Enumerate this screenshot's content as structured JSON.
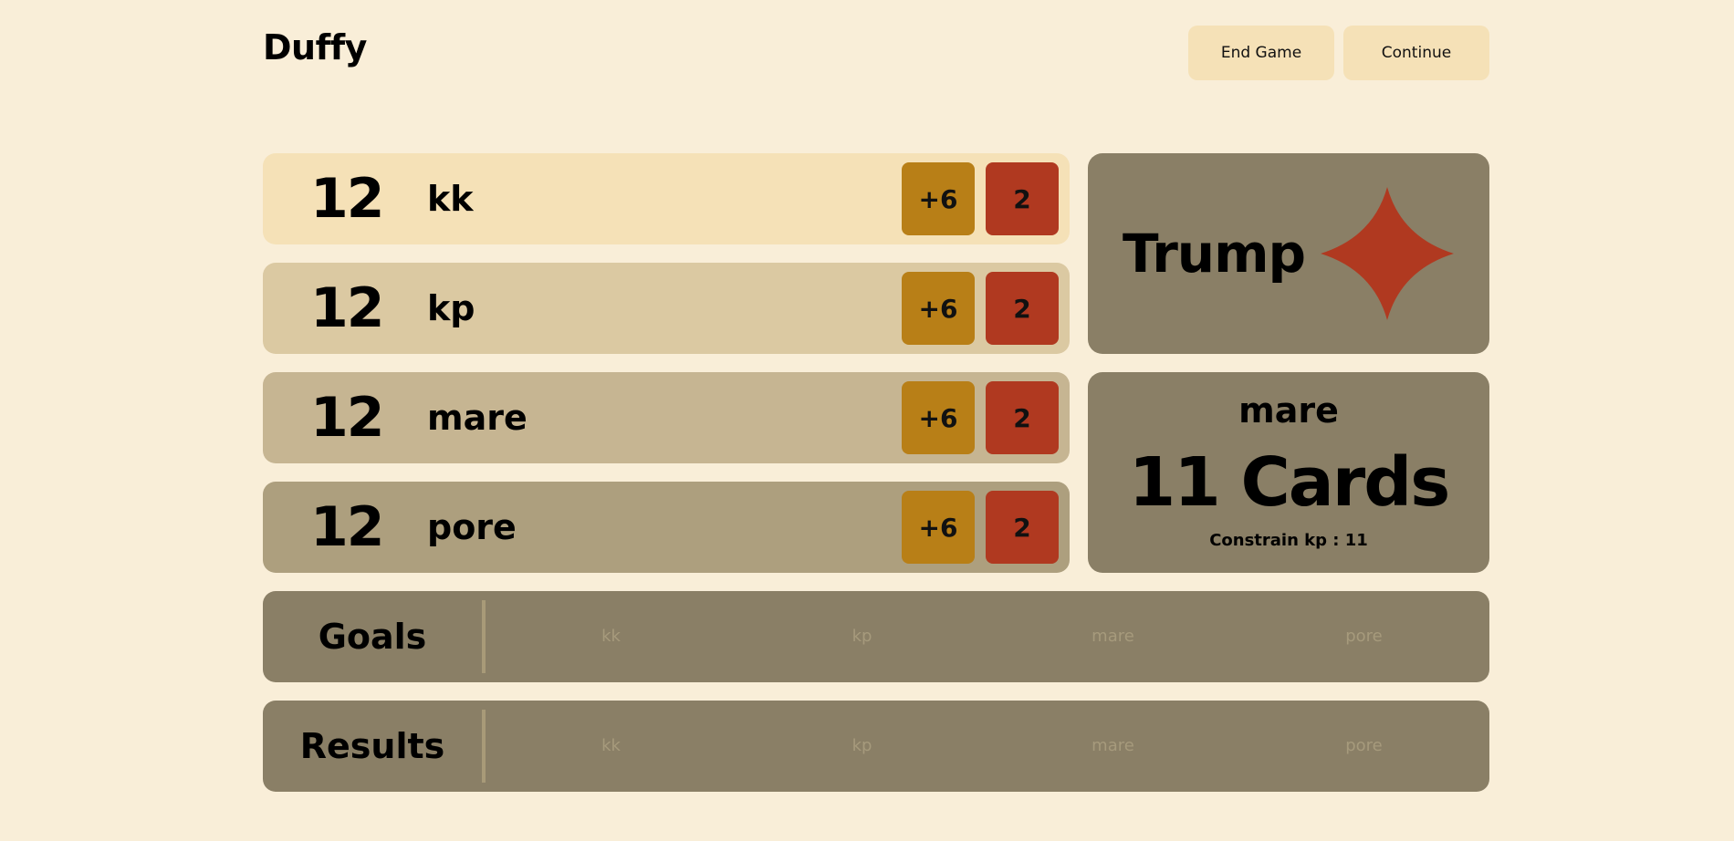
{
  "app": {
    "title": "Duffy"
  },
  "header": {
    "end_game_label": "End Game",
    "continue_label": "Continue"
  },
  "players": [
    {
      "score": "12",
      "name": "kk",
      "bid_label": "+6",
      "count_label": "2",
      "color": "#f5e1b7"
    },
    {
      "score": "12",
      "name": "kp",
      "bid_label": "+6",
      "count_label": "2",
      "color": "#dbc9a2"
    },
    {
      "score": "12",
      "name": "mare",
      "bid_label": "+6",
      "count_label": "2",
      "color": "#c6b592"
    },
    {
      "score": "12",
      "name": "pore",
      "bid_label": "+6",
      "count_label": "2",
      "color": "#ad9f7e"
    }
  ],
  "trump": {
    "label": "Trump",
    "suit_icon": "diamond-icon",
    "suit_color": "#b03920"
  },
  "turn": {
    "player": "mare",
    "cards": "11 Cards",
    "constraint": "Constrain kp : 11"
  },
  "goals": {
    "title": "Goals",
    "players": [
      "kk",
      "kp",
      "mare",
      "pore"
    ]
  },
  "results": {
    "title": "Results",
    "players": [
      "kk",
      "kp",
      "mare",
      "pore"
    ]
  },
  "colors": {
    "background": "#f9eed8",
    "panel": "#8a7f66",
    "bid_button": "#b87f17",
    "count_button": "#b03920",
    "header_button": "#f5e1b7"
  }
}
